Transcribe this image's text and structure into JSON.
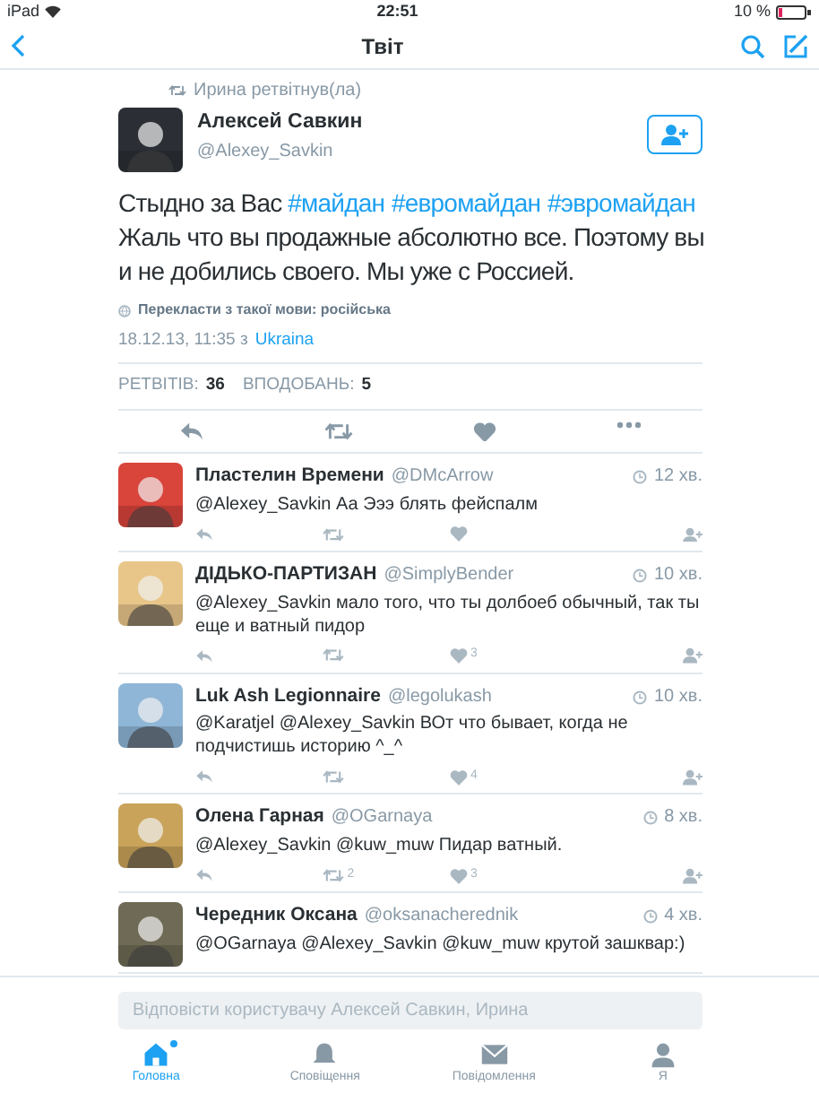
{
  "status_bar": {
    "device": "iPad",
    "time": "22:51",
    "battery": "10 %"
  },
  "nav": {
    "title": "Твіт"
  },
  "retweeted_by": "Ирина ретвітнув(ла)",
  "tweet": {
    "name": "Алексей Савкин",
    "handle": "@Alexey_Savkin",
    "text": [
      {
        "kind": "text",
        "text": "Стыдно за Вас "
      },
      {
        "kind": "hashtag",
        "text": "#майдан"
      },
      {
        "kind": "hashtag",
        "text": "#евромайдан"
      },
      {
        "kind": "hashtag",
        "text": "#эвромайдан"
      },
      {
        "kind": "text",
        "text": " Жаль что вы продажные абсолютно все. Поэтому вы и не добились своего. Мы уже с  Россией."
      }
    ],
    "translate": "Перекласти з такої мови: російська",
    "date": "18.12.13, 11:35 з",
    "place": "Ukraina",
    "stats": [
      {
        "label": "РЕТВІТІВ:",
        "value": "36"
      },
      {
        "label": "ВПОДОБАНЬ:",
        "value": "5"
      }
    ]
  },
  "replies": [
    {
      "name": "Пластелин Времени",
      "handle": "@DMcArrow",
      "time": "12 хв.",
      "text": "@Alexey_Savkin Аа Эээ блять фейспалм",
      "show_actions": true
    },
    {
      "name": "ДІДЬКО-ПАРТИЗАН",
      "handle": "@SimplyBender",
      "time": "10 хв.",
      "text": "@Alexey_Savkin мало того, что ты долбоеб обычный, так ты еще и ватный пидор",
      "likes": "3",
      "show_actions": true
    },
    {
      "name": "Luk Ash Legionnaire",
      "handle": "@legolukash",
      "time": "10 хв.",
      "text": "@Karatjel @Alexey_Savkin ВОт что бывает, когда не подчистишь историю ^_^",
      "likes": "4",
      "show_actions": true
    },
    {
      "name": "Олена Гарная",
      "handle": "@OGarnaya",
      "time": "8 хв.",
      "text": "@Alexey_Savkin @kuw_muw Пидар ватный.",
      "retweets": "2",
      "likes": "3",
      "show_actions": true
    },
    {
      "name": "Чередник Оксана",
      "handle": "@oksanacherednik",
      "time": "4 хв.",
      "text": "@OGarnaya @Alexey_Savkin @kuw_muw крутой зашквар:)",
      "show_actions": false
    }
  ],
  "composer": {
    "placeholder": "Відповісти користувачу Алексей Савкин, Ирина"
  },
  "tabs": [
    {
      "label": "Головна",
      "selected": true,
      "badge": true
    },
    {
      "label": "Сповіщення",
      "selected": false,
      "badge": false
    },
    {
      "label": "Повідомлення",
      "selected": false,
      "badge": false
    },
    {
      "label": "Я",
      "selected": false,
      "badge": false
    }
  ]
}
